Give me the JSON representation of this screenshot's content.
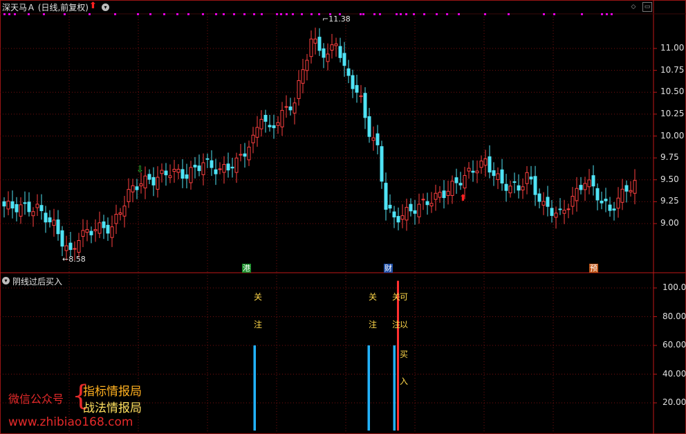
{
  "header": {
    "title": "深天马Ａ (日线,前复权)",
    "collapse_icon": "chevron-down-icon",
    "signal_icon": "red-up-arrow-icon",
    "window_buttons": [
      "diamond-icon",
      "window-icon"
    ]
  },
  "price_axis": {
    "labels": [
      "11.00",
      "10.75",
      "10.50",
      "10.25",
      "10.00",
      "9.75",
      "9.50",
      "9.25",
      "9.00"
    ],
    "values": [
      11.0,
      10.75,
      10.5,
      10.25,
      10.0,
      9.75,
      9.5,
      9.25,
      9.0
    ]
  },
  "price_annotations": {
    "high": "11.38",
    "low": "8.58"
  },
  "badges": [
    {
      "text": "港",
      "color": "#1a8f2a"
    },
    {
      "text": "财",
      "color": "#1f4fa8"
    },
    {
      "text": "预",
      "color": "#c2581a"
    }
  ],
  "indicator": {
    "title": "阴线过后买入",
    "axis_labels": [
      "100.0",
      "80.00",
      "60.00",
      "40.00",
      "20.00"
    ],
    "axis_values": [
      100,
      80,
      60,
      40,
      20
    ],
    "signals": [
      {
        "chars": [
          "关",
          "注"
        ],
        "value": 60
      },
      {
        "chars": [
          "关",
          "注"
        ],
        "value": 60
      },
      {
        "chars": [
          "关",
          "注"
        ],
        "value": 60
      },
      {
        "chars": [
          "可",
          "以",
          "买",
          "入"
        ],
        "value": 100
      }
    ]
  },
  "watermark": {
    "left": "微信公众号",
    "line1": "指标情报局",
    "line2": "战法情报局",
    "url": "www.zhibiao168.com"
  },
  "colors": {
    "up": "#ff4040",
    "down": "#4fe3f5",
    "grid": "#7a1010",
    "signal_bar": "#22b3ff",
    "buy_bar": "#ff3030",
    "magenta_dots": "#e000e0"
  }
}
